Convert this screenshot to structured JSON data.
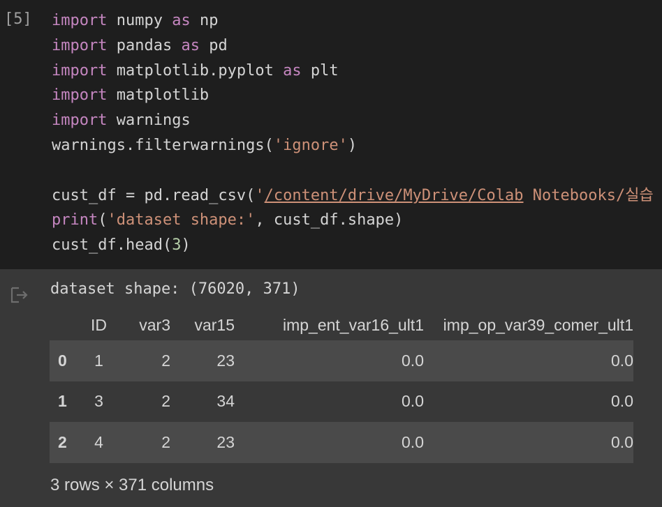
{
  "cell": {
    "execution_count": "[5]",
    "lines": [
      [
        {
          "t": "import",
          "c": "kw"
        },
        {
          "t": " numpy ",
          "c": ""
        },
        {
          "t": "as",
          "c": "kw"
        },
        {
          "t": " np",
          "c": ""
        }
      ],
      [
        {
          "t": "import",
          "c": "kw"
        },
        {
          "t": " pandas ",
          "c": ""
        },
        {
          "t": "as",
          "c": "kw"
        },
        {
          "t": " pd",
          "c": ""
        }
      ],
      [
        {
          "t": "import",
          "c": "kw"
        },
        {
          "t": " matplotlib.pyplot ",
          "c": ""
        },
        {
          "t": "as",
          "c": "kw"
        },
        {
          "t": " plt",
          "c": ""
        }
      ],
      [
        {
          "t": "import",
          "c": "kw"
        },
        {
          "t": " matplotlib",
          "c": ""
        }
      ],
      [
        {
          "t": "import",
          "c": "kw"
        },
        {
          "t": " warnings",
          "c": ""
        }
      ],
      [
        {
          "t": "warnings.filterwarnings(",
          "c": ""
        },
        {
          "t": "'ignore'",
          "c": "str"
        },
        {
          "t": ")",
          "c": ""
        }
      ],
      [
        {
          "t": "",
          "c": ""
        }
      ],
      [
        {
          "t": "cust_df = pd.read_csv(",
          "c": ""
        },
        {
          "t": "'",
          "c": "str"
        },
        {
          "t": "/content/drive/MyDrive/Colab",
          "c": "str link"
        },
        {
          "t": " Notebooks/실습",
          "c": "str"
        }
      ],
      [
        {
          "t": "print",
          "c": "kw"
        },
        {
          "t": "(",
          "c": ""
        },
        {
          "t": "'dataset shape:'",
          "c": "str"
        },
        {
          "t": ", cust_df.shape)",
          "c": ""
        }
      ],
      [
        {
          "t": "cust_df.head(",
          "c": ""
        },
        {
          "t": "3",
          "c": "num"
        },
        {
          "t": ")",
          "c": ""
        }
      ]
    ]
  },
  "output": {
    "stdout": "dataset shape: (76020, 371)",
    "table": {
      "columns": [
        "",
        "ID",
        "var3",
        "var15",
        "imp_ent_var16_ult1",
        "imp_op_var39_comer_ult1"
      ],
      "rows": [
        [
          "0",
          "1",
          "2",
          "23",
          "0.0",
          "0.0"
        ],
        [
          "1",
          "3",
          "2",
          "34",
          "0.0",
          "0.0"
        ],
        [
          "2",
          "4",
          "2",
          "23",
          "0.0",
          "0.0"
        ]
      ]
    },
    "shape_text": "3 rows × 371 columns"
  },
  "icons": {
    "output_icon": "output-redirect-icon"
  },
  "colors": {
    "code_bg": "#1e1e1e",
    "output_bg": "#383838",
    "keyword": "#c586c0",
    "string": "#ce9178",
    "number": "#b5cea8"
  }
}
